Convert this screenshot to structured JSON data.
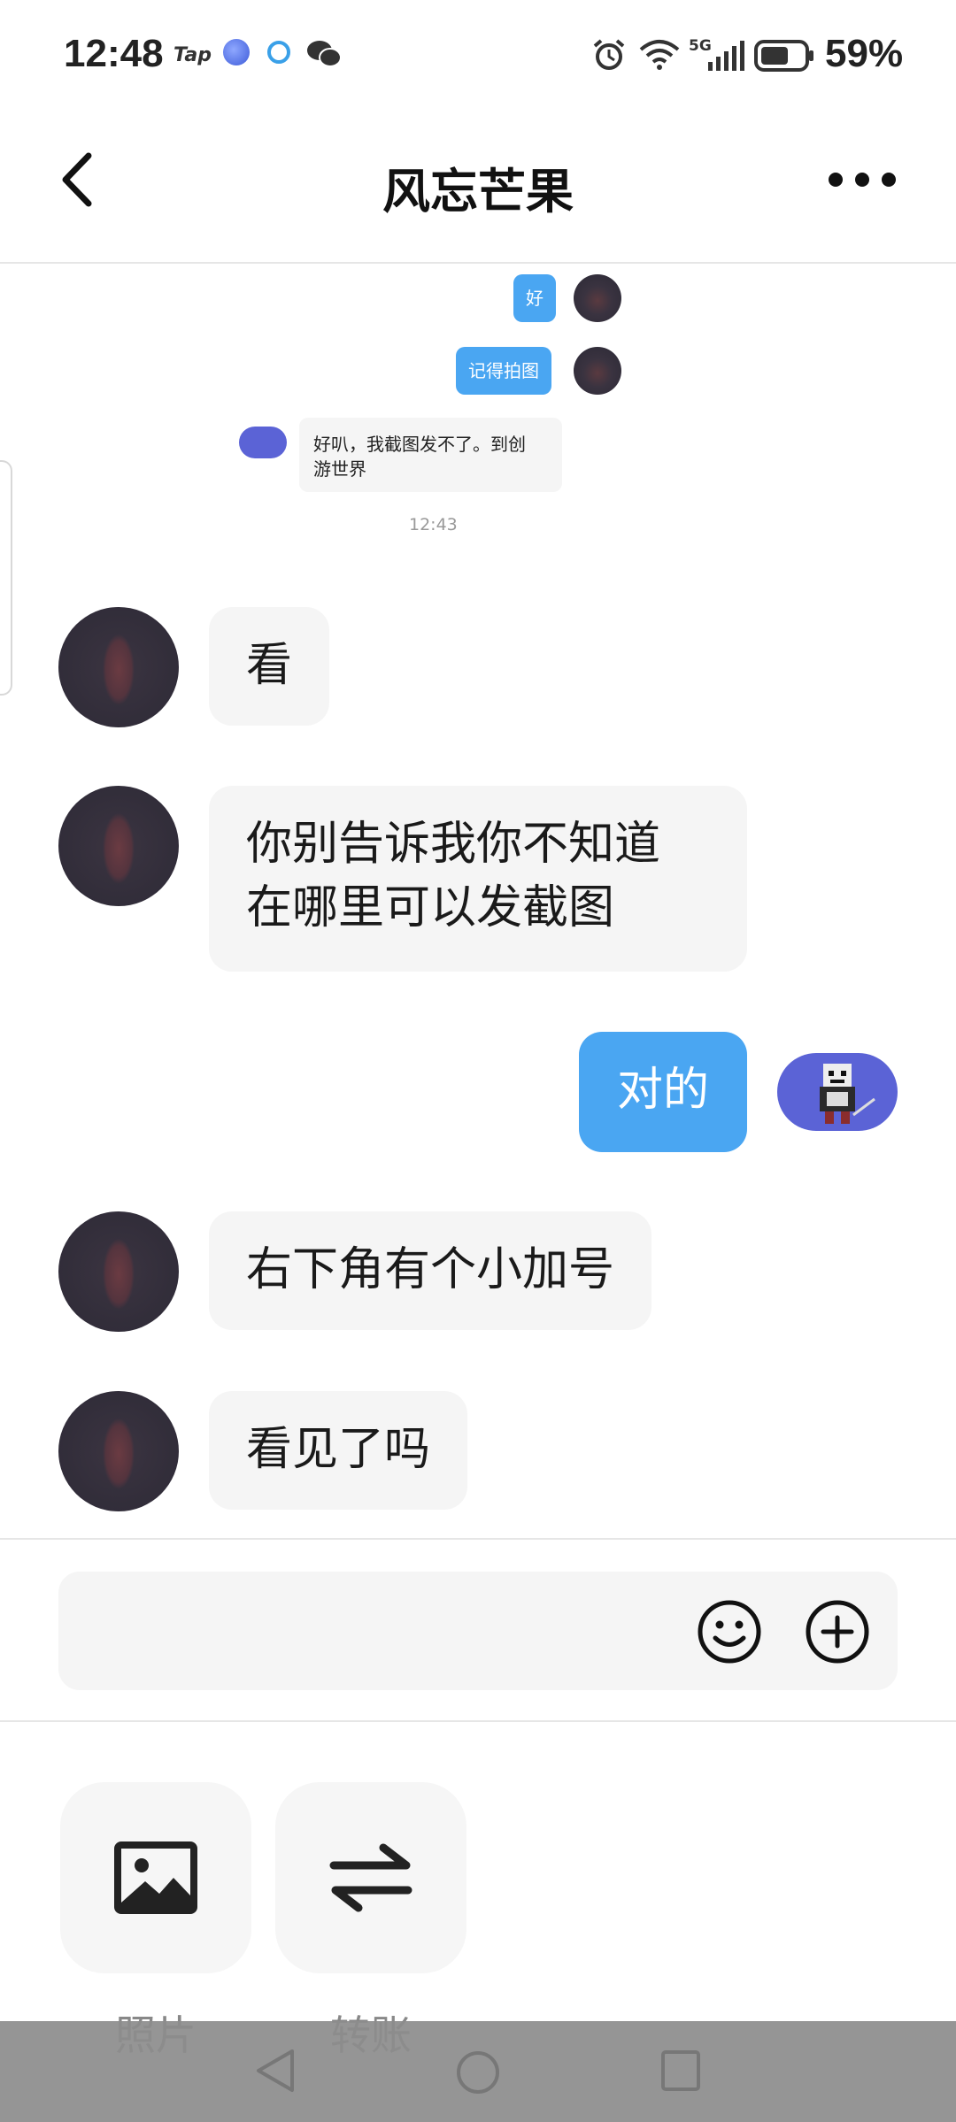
{
  "status_bar": {
    "time": "12:48",
    "tap_label": "Tap",
    "network": "5G",
    "battery_percent": "59%"
  },
  "header": {
    "title": "风忘芒果",
    "back_icon": "chevron-left-icon",
    "more_icon": "more-horizontal-icon"
  },
  "preview_messages": {
    "msg1": "好",
    "msg2": "记得拍图",
    "msg3_line1": "好叭，我截图发不了。到创",
    "msg3_line2": "游世界",
    "timestamp": "12:43"
  },
  "messages": [
    {
      "from": "other",
      "text": "看"
    },
    {
      "from": "other",
      "line1": "你别告诉我你不知道",
      "line2": "在哪里可以发截图"
    },
    {
      "from": "me",
      "text": "对的"
    },
    {
      "from": "other",
      "text": "右下角有个小加号"
    },
    {
      "from": "other",
      "text": "看见了吗"
    }
  ],
  "input": {
    "placeholder": "",
    "emoji_icon": "smile-icon",
    "plus_icon": "plus-circle-icon"
  },
  "tools": [
    {
      "label": "照片",
      "icon": "image-icon"
    },
    {
      "label": "转账",
      "icon": "transfer-arrows-icon"
    }
  ],
  "colors": {
    "accent_blue": "#4aa6f2",
    "bubble_grey": "#f5f5f5"
  }
}
